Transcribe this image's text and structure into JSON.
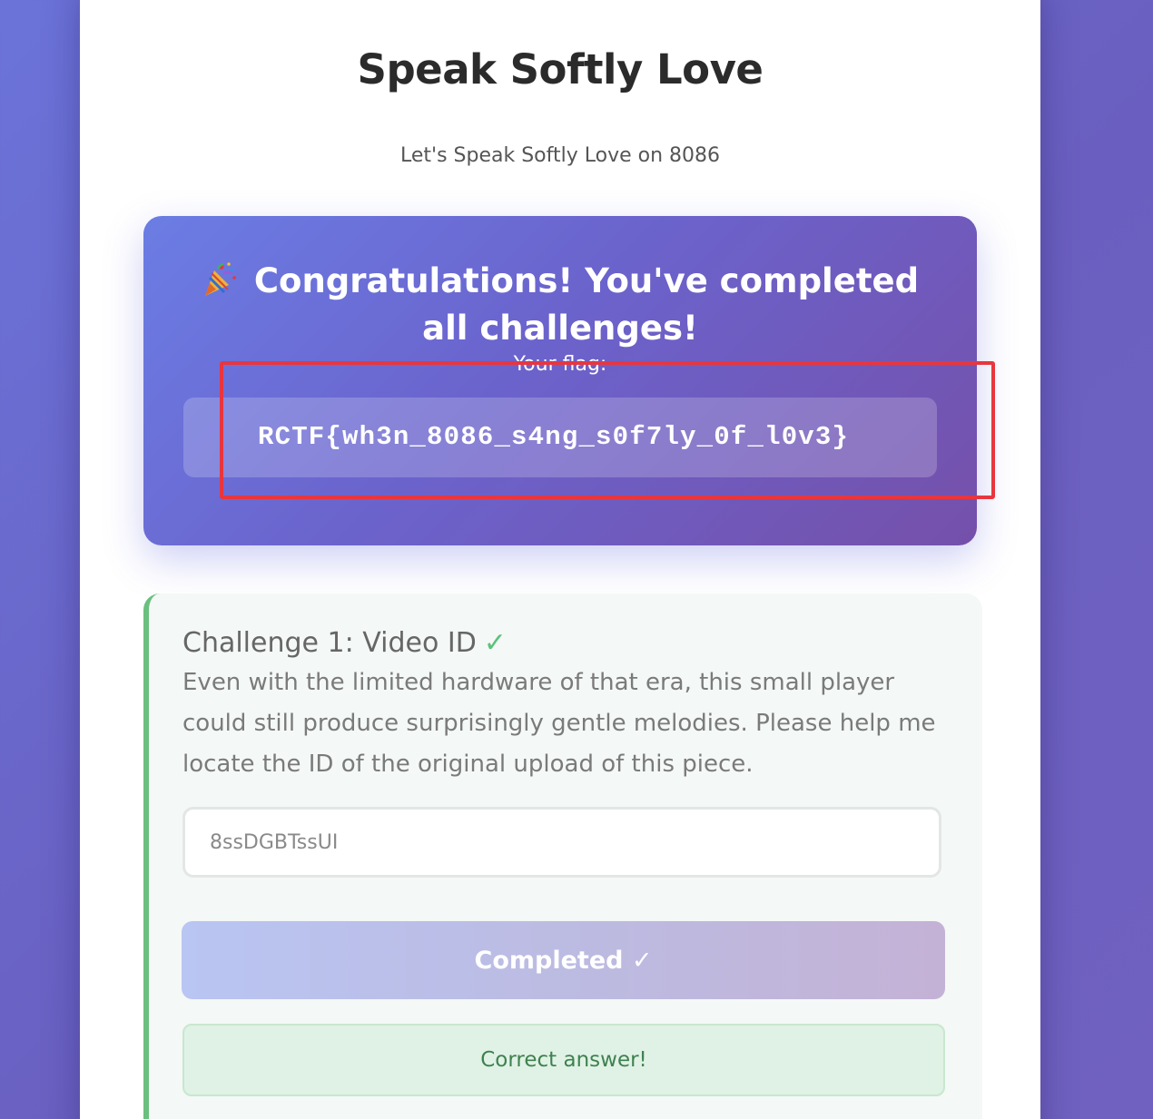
{
  "header": {
    "title": "Speak Softly Love",
    "subtitle": "Let's Speak Softly Love on 8086"
  },
  "congrats": {
    "icon": "party-popper-icon",
    "heading": "Congratulations! You've completed all challenges!",
    "flag_label": "Your flag:",
    "flag": "RCTF{wh3n_8086_s4ng_s0f7ly_0f_l0v3}"
  },
  "challenge": {
    "title": "Challenge 1: Video ID",
    "check": "✓",
    "description": "Even with the limited hardware of that era, this small player could still produce surprisingly gentle melodies. Please help me locate the ID of the original upload of this piece.",
    "answer_value": "8ssDGBTssUI",
    "button_label": "Completed ✓",
    "result": "Correct answer!"
  },
  "colors": {
    "accent_start": "#6b7de4",
    "accent_end": "#7550aa",
    "success": "#6bbf7f",
    "highlight": "#e8363e"
  }
}
